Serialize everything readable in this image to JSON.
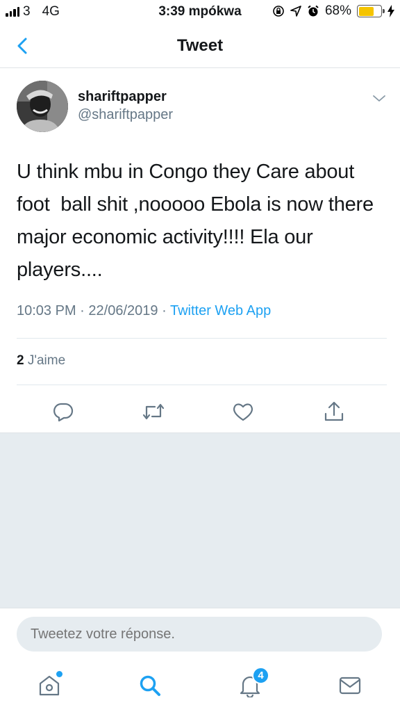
{
  "status_bar": {
    "carrier": "3",
    "network": "4G",
    "time": "3:39 mpókwa",
    "battery_percent": "68%",
    "battery_level": 0.68,
    "battery_color": "#f5c400"
  },
  "nav": {
    "title": "Tweet"
  },
  "tweet": {
    "display_name": "shariftpapper",
    "handle": "@shariftpapper",
    "text": "U think mbu in Congo they Care about\nfoot  ball shit ,nooooo Ebola is now there\nmajor economic activity!!!! Ela our\nplayers....",
    "time": "10:03 PM",
    "date": "22/06/2019",
    "source": "Twitter Web App",
    "separator": "·",
    "likes_count": "2",
    "likes_label": "J'aime"
  },
  "actions": [
    "reply-icon",
    "retweet-icon",
    "like-icon",
    "share-icon"
  ],
  "reply": {
    "placeholder": "Tweetez votre réponse."
  },
  "tab_bar": {
    "notifications_badge": "4"
  },
  "colors": {
    "accent": "#1da1f2",
    "secondary_text": "#657786",
    "background_gray": "#e6ecf0"
  }
}
